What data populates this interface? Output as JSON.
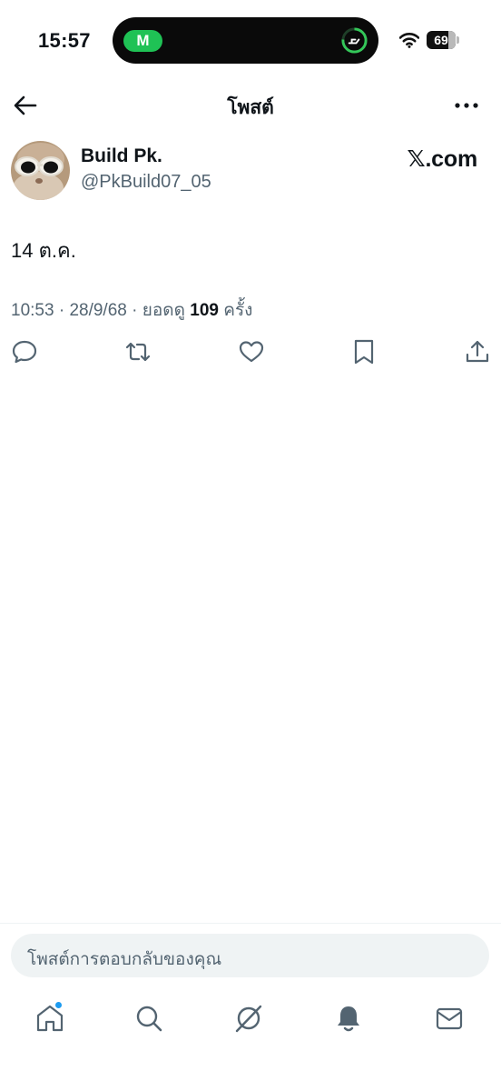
{
  "status_bar": {
    "time": "15:57",
    "island_app": "M",
    "battery": "69",
    "colors": {
      "island_app": "#1fc255",
      "ring": "#34c759"
    }
  },
  "header": {
    "title": "โพสต์",
    "back_icon": "arrow-left-icon",
    "more_icon": "more-horizontal-icon"
  },
  "post": {
    "author_name": "Build Pk.",
    "author_handle": "@PkBuild07_05",
    "source_label": "𝕏.com",
    "text": "14 ต.ค.",
    "time": "10:53",
    "date": "28/9/68",
    "views_prefix": "ยอดดู",
    "views_count": "109",
    "views_suffix": "ครั้ง"
  },
  "actions": [
    "reply-icon",
    "repost-icon",
    "like-icon",
    "bookmark-icon",
    "share-icon"
  ],
  "reply_box": {
    "placeholder": "โพสต์การตอบกลับของคุณ"
  },
  "bottom_nav": {
    "items": [
      "home-icon",
      "search-icon",
      "grok-icon",
      "notifications-icon",
      "messages-icon"
    ],
    "accent": "#1d9bf0"
  }
}
